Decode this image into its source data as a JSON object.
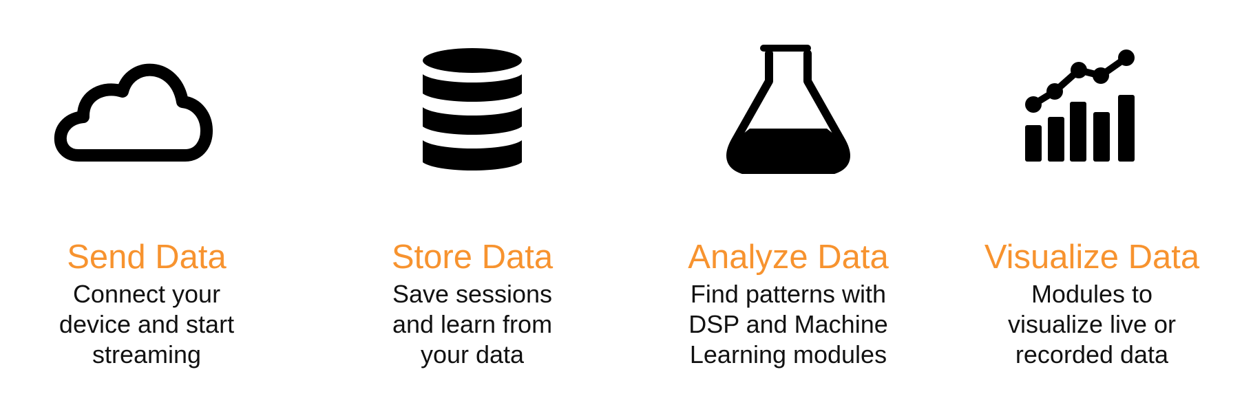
{
  "features": [
    {
      "icon": "cloud-icon",
      "title": "Send Data",
      "description": "Connect your\ndevice and start\nstreaming"
    },
    {
      "icon": "database-icon",
      "title": "Store Data",
      "description": "Save sessions\nand learn from\nyour data"
    },
    {
      "icon": "flask-icon",
      "title": "Analyze Data",
      "description": "Find patterns with\nDSP and Machine\nLearning modules"
    },
    {
      "icon": "chart-icon",
      "title": "Visualize Data",
      "description": "Modules to\nvisualize live or\nrecorded data"
    }
  ],
  "colors": {
    "accent": "#f7932f",
    "text": "#111111",
    "icon": "#000000",
    "background": "#ffffff"
  }
}
